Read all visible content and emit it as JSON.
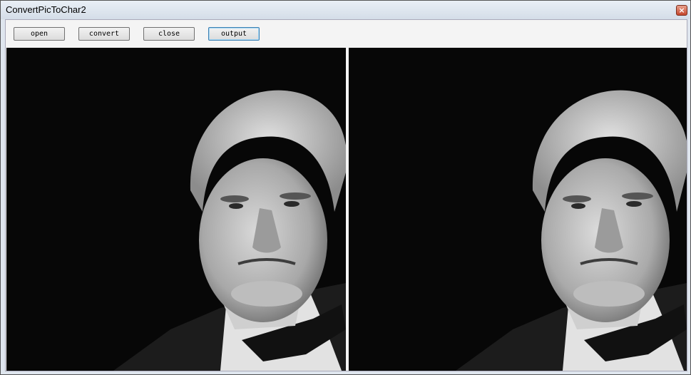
{
  "window": {
    "title": "ConvertPicToChar2",
    "close_glyph": "×"
  },
  "toolbar": {
    "open_label": "open",
    "convert_label": "convert",
    "close_label": "close",
    "output_label": "output"
  },
  "panes": {
    "left": {
      "content": "portrait-photo"
    },
    "right": {
      "content": "portrait-photo-converted"
    }
  },
  "colors": {
    "image_background": "#070707"
  }
}
